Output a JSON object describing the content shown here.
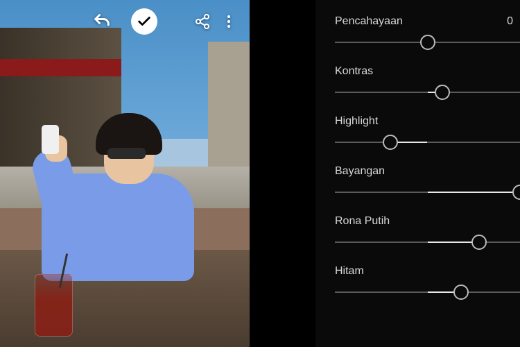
{
  "toolbar": {
    "undo": "undo",
    "confirm": "confirm",
    "share": "share",
    "more": "more"
  },
  "sliders": [
    {
      "label": "Pencahayaan",
      "value": "0",
      "thumb_pct": 50,
      "active_from_pct": 50,
      "active_to_pct": 50
    },
    {
      "label": "Kontras",
      "value": "",
      "thumb_pct": 58,
      "active_from_pct": 50,
      "active_to_pct": 58
    },
    {
      "label": "Highlight",
      "value": "",
      "thumb_pct": 30,
      "active_from_pct": 30,
      "active_to_pct": 50
    },
    {
      "label": "Bayangan",
      "value": "",
      "thumb_pct": 100,
      "active_from_pct": 50,
      "active_to_pct": 100
    },
    {
      "label": "Rona Putih",
      "value": "",
      "thumb_pct": 78,
      "active_from_pct": 50,
      "active_to_pct": 78
    },
    {
      "label": "Hitam",
      "value": "",
      "thumb_pct": 68,
      "active_from_pct": 50,
      "active_to_pct": 68
    }
  ]
}
